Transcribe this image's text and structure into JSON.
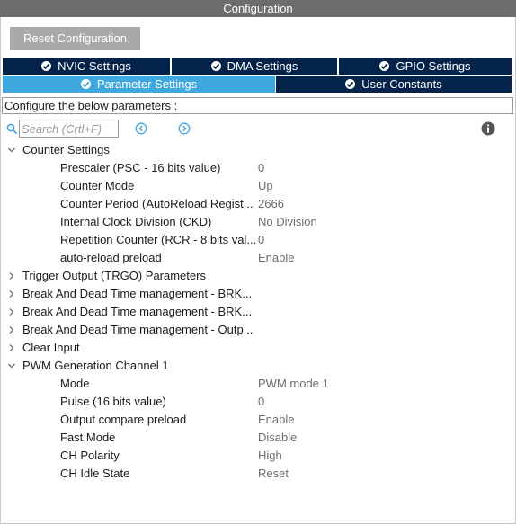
{
  "window": {
    "title": "Configuration"
  },
  "toolbar": {
    "reset_label": "Reset Configuration"
  },
  "tabs": [
    {
      "label": "NVIC Settings",
      "icon": "check-circle-icon",
      "active": false
    },
    {
      "label": "DMA Settings",
      "icon": "check-circle-icon",
      "active": false
    },
    {
      "label": "GPIO Settings",
      "icon": "check-circle-icon",
      "active": false
    },
    {
      "label": "Parameter Settings",
      "icon": "check-circle-icon",
      "active": true
    },
    {
      "label": "User Constants",
      "icon": "check-circle-icon",
      "active": false
    }
  ],
  "description": "Configure the below parameters :",
  "search": {
    "placeholder": "Search (Crtl+F)"
  },
  "tree": {
    "counter_settings": {
      "title": "Counter Settings",
      "expanded": true,
      "params": [
        {
          "label": "Prescaler (PSC - 16 bits value)",
          "value": "0"
        },
        {
          "label": "Counter Mode",
          "value": "Up"
        },
        {
          "label": "Counter Period (AutoReload Regist...",
          "value": "2666"
        },
        {
          "label": "Internal Clock Division (CKD)",
          "value": "No Division"
        },
        {
          "label": "Repetition Counter (RCR - 8 bits val...",
          "value": "0"
        },
        {
          "label": "auto-reload preload",
          "value": "Enable"
        }
      ]
    },
    "collapsed_groups": [
      "Trigger Output (TRGO) Parameters",
      "Break And Dead Time management - BRK...",
      "Break And Dead Time management - BRK...",
      "Break And Dead Time management - Outp...",
      "Clear Input"
    ],
    "pwm_channel_1": {
      "title": "PWM Generation Channel 1",
      "expanded": true,
      "params": [
        {
          "label": "Mode",
          "value": "PWM mode 1"
        },
        {
          "label": "Pulse (16 bits value)",
          "value": "0"
        },
        {
          "label": "Output compare preload",
          "value": "Enable"
        },
        {
          "label": "Fast Mode",
          "value": "Disable"
        },
        {
          "label": "CH Polarity",
          "value": "High"
        },
        {
          "label": "CH Idle State",
          "value": "Reset"
        }
      ]
    }
  },
  "colors": {
    "title_bar": "#6d6d6d",
    "tab_dark": "#03234b",
    "tab_active": "#3fa9df",
    "button_disabled": "#a9a9a9",
    "nav_icons": "#3fa9df",
    "value_text": "#6d6d6d"
  }
}
